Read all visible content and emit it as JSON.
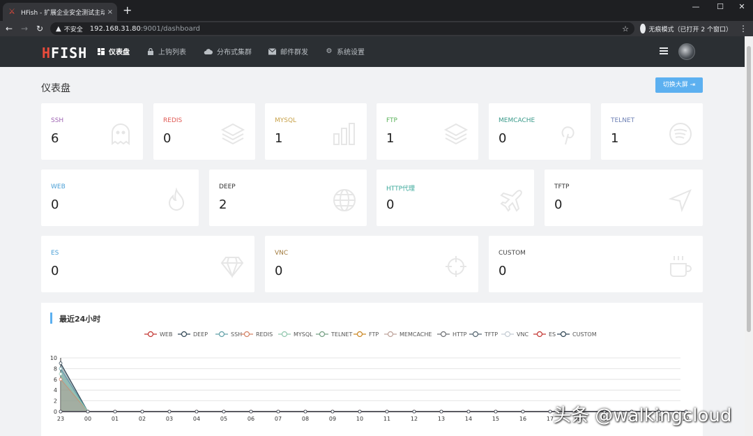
{
  "browser": {
    "tab_title": "HFish - 扩展企业安全测试主动诱",
    "tab_close": "×",
    "new_tab": "+",
    "security_label": "不安全",
    "url_host": "192.168.31.80",
    "url_path": ":9001/dashboard",
    "incognito_label": "无痕模式（已打开 2 个窗口）"
  },
  "app": {
    "logo_h": "H",
    "logo_rest": "FISH",
    "nav": [
      {
        "label": "仪表盘",
        "icon": "dashboard-icon",
        "active": true
      },
      {
        "label": "上钩列表",
        "icon": "lock-icon",
        "active": false
      },
      {
        "label": "分布式集群",
        "icon": "cloud-icon",
        "active": false
      },
      {
        "label": "邮件群发",
        "icon": "mail-icon",
        "active": false
      },
      {
        "label": "系统设置",
        "icon": "gear-icon",
        "active": false
      }
    ]
  },
  "page": {
    "title": "仪表盘",
    "fullscreen_label": "切换大屏"
  },
  "cards": [
    {
      "label": "SSH",
      "value": "6",
      "color": "#a066b4",
      "icon": "ghost-icon"
    },
    {
      "label": "REDIS",
      "value": "0",
      "color": "#e05a55",
      "icon": "layers-icon"
    },
    {
      "label": "MYSQL",
      "value": "1",
      "color": "#c8a24a",
      "icon": "bar-chart-icon"
    },
    {
      "label": "FTP",
      "value": "1",
      "color": "#5bb35b",
      "icon": "layers-icon"
    },
    {
      "label": "MEMCACHE",
      "value": "0",
      "color": "#3a9a8a",
      "icon": "pinterest-icon"
    },
    {
      "label": "TELNET",
      "value": "1",
      "color": "#6c7fb4",
      "icon": "spotify-icon"
    },
    {
      "label": "WEB",
      "value": "0",
      "color": "#4a9fd6",
      "icon": "fire-icon"
    },
    {
      "label": "DEEP",
      "value": "2",
      "color": "#333333",
      "icon": "globe-icon"
    },
    {
      "label": "HTTP代理",
      "value": "0",
      "color": "#3aa89a",
      "icon": "plane-icon"
    },
    {
      "label": "TFTP",
      "value": "0",
      "color": "#333333",
      "icon": "send-icon"
    },
    {
      "label": "ES",
      "value": "0",
      "color": "#4a9fd6",
      "icon": "diamond-icon"
    },
    {
      "label": "VNC",
      "value": "0",
      "color": "#a0783a",
      "icon": "crosshair-icon"
    },
    {
      "label": "CUSTOM",
      "value": "0",
      "color": "#444444",
      "icon": "coffee-icon"
    }
  ],
  "chart_panel": {
    "title": "最近24小时"
  },
  "chart_data": {
    "type": "area",
    "title": "最近24小时",
    "x": [
      "23",
      "00",
      "01",
      "02",
      "03",
      "04",
      "05",
      "06",
      "07",
      "08",
      "09",
      "10",
      "11",
      "12",
      "13",
      "14",
      "15",
      "16",
      "17",
      "18",
      "19",
      "20",
      "21",
      "22"
    ],
    "ylim": [
      0,
      10
    ],
    "yticks": [
      0,
      2,
      4,
      6,
      8,
      10
    ],
    "grid": true,
    "legend_position": "top-center",
    "series": [
      {
        "name": "WEB",
        "color": "#c23531",
        "values": [
          0,
          0,
          0,
          0,
          0,
          0,
          0,
          0,
          0,
          0,
          0,
          0,
          0,
          0,
          0,
          0,
          0,
          0,
          0,
          0,
          0,
          0,
          0,
          0
        ]
      },
      {
        "name": "DEEP",
        "color": "#2f4554",
        "values": [
          9,
          0,
          0,
          0,
          0,
          0,
          0,
          0,
          0,
          0,
          0,
          0,
          0,
          0,
          0,
          0,
          0,
          0,
          0,
          0,
          0,
          0,
          0,
          0
        ]
      },
      {
        "name": "SSH",
        "color": "#61a0a8",
        "values": [
          8,
          0,
          0,
          0,
          0,
          0,
          0,
          0,
          0,
          0,
          0,
          0,
          0,
          0,
          0,
          0,
          0,
          0,
          0,
          0,
          0,
          0,
          0,
          0
        ]
      },
      {
        "name": "REDIS",
        "color": "#d48265",
        "values": [
          6,
          0,
          0,
          0,
          0,
          0,
          0,
          0,
          0,
          0,
          0,
          0,
          0,
          0,
          0,
          0,
          0,
          0,
          0,
          0,
          0,
          0,
          0,
          0
        ]
      },
      {
        "name": "MYSQL",
        "color": "#91c7ae",
        "values": [
          7,
          0,
          0,
          0,
          0,
          0,
          0,
          0,
          0,
          0,
          0,
          0,
          0,
          0,
          0,
          0,
          0,
          0,
          0,
          0,
          0,
          0,
          0,
          0
        ]
      },
      {
        "name": "TELNET",
        "color": "#749f83",
        "values": [
          0,
          0,
          0,
          0,
          0,
          0,
          0,
          0,
          0,
          0,
          0,
          0,
          0,
          0,
          0,
          0,
          0,
          0,
          0,
          0,
          0,
          0,
          0,
          0
        ]
      },
      {
        "name": "FTP",
        "color": "#ca8622",
        "values": [
          0,
          0,
          0,
          0,
          0,
          0,
          0,
          0,
          0,
          0,
          0,
          0,
          0,
          0,
          0,
          0,
          0,
          0,
          0,
          0,
          0,
          0,
          0,
          0
        ]
      },
      {
        "name": "MEMCACHE",
        "color": "#bda29a",
        "values": [
          0,
          0,
          0,
          0,
          0,
          0,
          0,
          0,
          0,
          0,
          0,
          0,
          0,
          0,
          0,
          0,
          0,
          0,
          0,
          0,
          0,
          0,
          0,
          0
        ]
      },
      {
        "name": "HTTP",
        "color": "#6e7074",
        "values": [
          0,
          0,
          0,
          0,
          0,
          0,
          0,
          0,
          0,
          0,
          0,
          0,
          0,
          0,
          0,
          0,
          0,
          0,
          0,
          0,
          0,
          0,
          0,
          0
        ]
      },
      {
        "name": "TFTP",
        "color": "#546570",
        "values": [
          0,
          0,
          0,
          0,
          0,
          0,
          0,
          0,
          0,
          0,
          0,
          0,
          0,
          0,
          0,
          0,
          0,
          0,
          0,
          0,
          0,
          0,
          0,
          0
        ]
      },
      {
        "name": "VNC",
        "color": "#c4ccd3",
        "values": [
          0,
          0,
          0,
          0,
          0,
          0,
          0,
          0,
          0,
          0,
          0,
          0,
          0,
          0,
          0,
          0,
          0,
          0,
          0,
          0,
          0,
          0,
          0,
          0
        ]
      },
      {
        "name": "ES",
        "color": "#c23531",
        "values": [
          0,
          0,
          0,
          0,
          0,
          0,
          0,
          0,
          0,
          0,
          0,
          0,
          0,
          0,
          0,
          0,
          0,
          0,
          0,
          0,
          0,
          0,
          0,
          0
        ]
      },
      {
        "name": "CUSTOM",
        "color": "#2f4554",
        "values": [
          0,
          0,
          0,
          0,
          0,
          0,
          0,
          0,
          0,
          0,
          0,
          0,
          0,
          0,
          0,
          0,
          0,
          0,
          0,
          0,
          0,
          0,
          0,
          0
        ]
      }
    ]
  },
  "watermark": "头条 @walkingcloud"
}
